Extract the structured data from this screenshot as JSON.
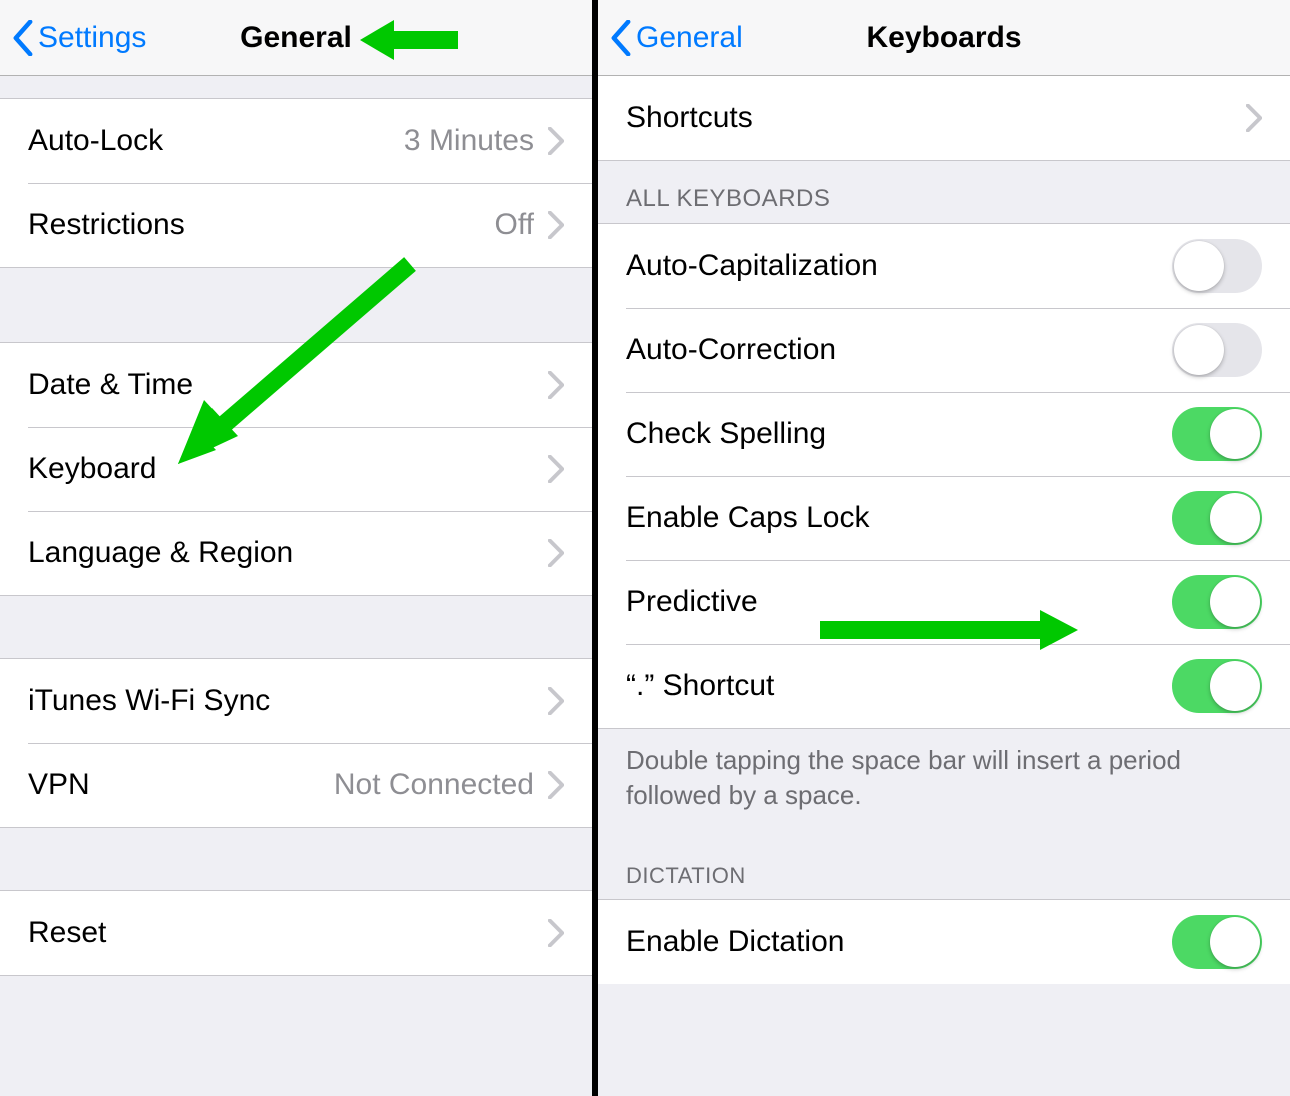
{
  "left": {
    "back_label": "Settings",
    "title": "General",
    "rows": {
      "autolock": {
        "label": "Auto-Lock",
        "value": "3 Minutes"
      },
      "restrictions": {
        "label": "Restrictions",
        "value": "Off"
      },
      "datetime": {
        "label": "Date & Time"
      },
      "keyboard": {
        "label": "Keyboard"
      },
      "language": {
        "label": "Language & Region"
      },
      "itunes": {
        "label": "iTunes Wi-Fi Sync"
      },
      "vpn": {
        "label": "VPN",
        "value": "Not Connected"
      },
      "reset": {
        "label": "Reset"
      }
    }
  },
  "right": {
    "back_label": "General",
    "title": "Keyboards",
    "rows": {
      "shortcuts": {
        "label": "Shortcuts"
      }
    },
    "section_all": "ALL KEYBOARDS",
    "toggles": {
      "autocaps": {
        "label": "Auto-Capitalization",
        "on": false
      },
      "autocorrect": {
        "label": "Auto-Correction",
        "on": false
      },
      "spell": {
        "label": "Check Spelling",
        "on": true
      },
      "capslock": {
        "label": "Enable Caps Lock",
        "on": true
      },
      "predictive": {
        "label": "Predictive",
        "on": true
      },
      "period": {
        "label": "“.” Shortcut",
        "on": true
      }
    },
    "footer": "Double tapping the space bar will insert a period followed by a space.",
    "section_dict": "DICTATION",
    "dictation": {
      "label": "Enable Dictation",
      "on": true
    }
  },
  "colors": {
    "accent": "#007aff",
    "toggle_on": "#4cd964",
    "arrow": "#00c800"
  }
}
